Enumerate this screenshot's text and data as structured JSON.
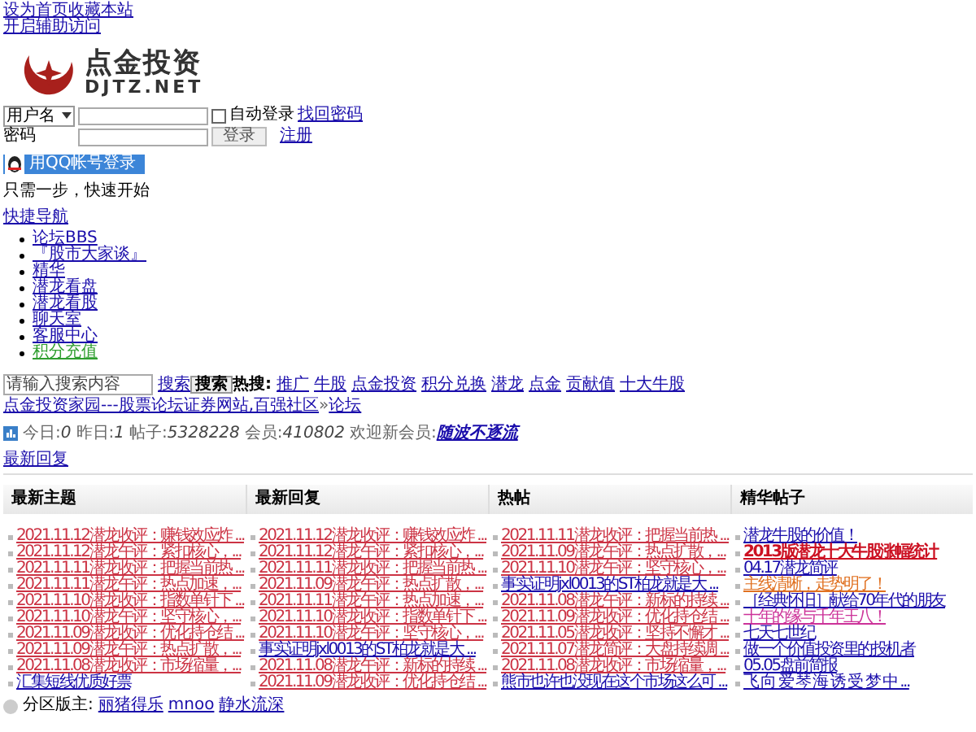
{
  "top_links": [
    "设为首页收藏本站",
    "开启辅助访问"
  ],
  "logo": {
    "title": "点金投资",
    "subtitle": "DJTZ.NET"
  },
  "login": {
    "user_select": "用户名",
    "auto_login": {
      "label": "自动登录",
      "checked": false
    },
    "find_password": "找回密码",
    "password_label": "密码",
    "login_button": "登录",
    "register": "注册",
    "qq_button": "用QQ帐号登录"
  },
  "tagline": "只需一步，快速开始",
  "quick_nav": {
    "title": "快捷导航",
    "items": [
      {
        "label": "论坛BBS",
        "color": "#1a0dab"
      },
      {
        "label": "『股市大家谈』",
        "color": "#1a0dab"
      },
      {
        "label": "精华",
        "color": "#1a0dab"
      },
      {
        "label": "潜龙看盘",
        "color": "#1a0dab"
      },
      {
        "label": "潜龙看股",
        "color": "#1a0dab"
      },
      {
        "label": "聊天室",
        "color": "#1a0dab"
      },
      {
        "label": "客服中心",
        "color": "#1a0dab"
      },
      {
        "label": "积分充值",
        "color": "#2e9e2e"
      }
    ]
  },
  "search": {
    "placeholder": "请输入搜索内容",
    "link": "搜索",
    "button": "搜索",
    "hot_label": "热搜:",
    "hot": [
      "推广",
      "牛股",
      "点金投资",
      "积分兑换",
      "潜龙",
      "点金",
      "贡献值",
      "十大牛股"
    ]
  },
  "breadcrumb": [
    "点金投资家园---股票论坛证券网站,百强社区",
    "论坛"
  ],
  "breadcrumb_separator": "»",
  "stats": {
    "today_label": "今日:",
    "today": "0",
    "yesterday_label": "昨日:",
    "yesterday": "1",
    "posts_label": "帖子:",
    "posts": "5328228",
    "members_label": "会员:",
    "members": "410802",
    "welcome_label": "欢迎新会员:",
    "new_member": "随波不逐流"
  },
  "latest_reply_link": "最新回复",
  "columns": [
    {
      "title": "最新主题",
      "items": [
        {
          "text": "2021.11.12潜龙收评：赚钱效应炸 ...",
          "color": "#cc3344",
          "bold": false
        },
        {
          "text": "2021.11.12潜龙午评：紧扣核心，...",
          "color": "#cc3344",
          "bold": false
        },
        {
          "text": "2021.11.11潜龙收评：把握当前热 ...",
          "color": "#cc3344",
          "bold": false
        },
        {
          "text": "2021.11.11潜龙午评：热点加速，...",
          "color": "#cc3344",
          "bold": false
        },
        {
          "text": "2021.11.10潜龙收评：指数单针下 ...",
          "color": "#cc3344",
          "bold": false
        },
        {
          "text": "2021.11.10潜龙午评：坚守核心，...",
          "color": "#cc3344",
          "bold": false
        },
        {
          "text": "2021.11.09潜龙收评：优化持仓结 ...",
          "color": "#cc3344",
          "bold": false
        },
        {
          "text": "2021.11.09潜龙午评：热点扩散，...",
          "color": "#cc3344",
          "bold": false
        },
        {
          "text": "2021.11.08潜龙收评：市场缩量，...",
          "color": "#cc3344",
          "bold": false
        },
        {
          "text": "汇集短线优质好票",
          "color": "#1a0dab",
          "bold": false
        }
      ]
    },
    {
      "title": "最新回复",
      "items": [
        {
          "text": "2021.11.12潜龙收评：赚钱效应炸 ...",
          "color": "#cc3344",
          "bold": false
        },
        {
          "text": "2021.11.12潜龙午评：紧扣核心，...",
          "color": "#cc3344",
          "bold": false
        },
        {
          "text": "2021.11.11潜龙收评：把握当前热 ...",
          "color": "#cc3344",
          "bold": false
        },
        {
          "text": "2021.11.09潜龙午评：热点扩散，...",
          "color": "#cc3344",
          "bold": false
        },
        {
          "text": "2021.11.11潜龙午评：热点加速，...",
          "color": "#cc3344",
          "bold": false
        },
        {
          "text": "2021.11.10潜龙收评：指数单针下 ...",
          "color": "#cc3344",
          "bold": false
        },
        {
          "text": "2021.11.10潜龙午评：坚守核心，...",
          "color": "#cc3344",
          "bold": false
        },
        {
          "text": "事实证明jxl0013的ST柏龙就是大 ...",
          "color": "#1a0dab",
          "bold": false
        },
        {
          "text": "2021.11.08潜龙午评：新标的持续 ...",
          "color": "#cc3344",
          "bold": false
        },
        {
          "text": "2021.11.09潜龙收评：优化持仓结 ...",
          "color": "#cc3344",
          "bold": false
        }
      ]
    },
    {
      "title": "热帖",
      "items": [
        {
          "text": "2021.11.11潜龙收评：把握当前热 ...",
          "color": "#cc3344",
          "bold": false
        },
        {
          "text": "2021.11.09潜龙午评：热点扩散，...",
          "color": "#cc3344",
          "bold": false
        },
        {
          "text": "2021.11.10潜龙午评：坚守核心，...",
          "color": "#cc3344",
          "bold": false
        },
        {
          "text": "事实证明jxl0013的ST柏龙就是大 ...",
          "color": "#1a0dab",
          "bold": false
        },
        {
          "text": "2021.11.08潜龙午评：新标的持续 ...",
          "color": "#cc3344",
          "bold": false
        },
        {
          "text": "2021.11.09潜龙收评：优化持仓结 ...",
          "color": "#cc3344",
          "bold": false
        },
        {
          "text": "2021.11.05潜龙收评：坚持不懈才 ...",
          "color": "#cc3344",
          "bold": false
        },
        {
          "text": "2021.11.07潜龙简评：大盘持续调 ...",
          "color": "#cc3344",
          "bold": false
        },
        {
          "text": "2021.11.08潜龙收评：市场缩量，...",
          "color": "#cc3344",
          "bold": false
        },
        {
          "text": "熊市也许也没现在这个市场这么可 ...",
          "color": "#1a0dab",
          "bold": false
        }
      ]
    },
    {
      "title": "精华帖子",
      "items": [
        {
          "text": "潜龙牛股的价值！",
          "color": "#1a0dab",
          "bold": false
        },
        {
          "text": "2013版潜龙十大牛股涨幅统计",
          "color": "#cc1122",
          "bold": true
        },
        {
          "text": "04.17潜龙简评",
          "color": "#1a0dab",
          "bold": false
        },
        {
          "text": "主线清晰，走势明了！",
          "color": "#e07020",
          "bold": false
        },
        {
          "text": "［经典怀旧］献给70年代的朋友",
          "color": "#1a0dab",
          "bold": false
        },
        {
          "text": "十年的缘与千年王八！",
          "color": "#cc3399",
          "bold": false
        },
        {
          "text": "七天七世纪",
          "color": "#1a0dab",
          "bold": false
        },
        {
          "text": "做一个价值投资里的投机者",
          "color": "#1a0dab",
          "bold": false
        },
        {
          "text": "05.05盘前简报",
          "color": "#1a0dab",
          "bold": false
        },
        {
          "text": "飞 向 爱 琴 海 诱 受 梦 中 ...",
          "color": "#1a0dab",
          "bold": false
        }
      ]
    }
  ],
  "moderators": {
    "label": "分区版主:",
    "names": [
      "丽猪得乐",
      "mnoo",
      "静水流深"
    ]
  }
}
